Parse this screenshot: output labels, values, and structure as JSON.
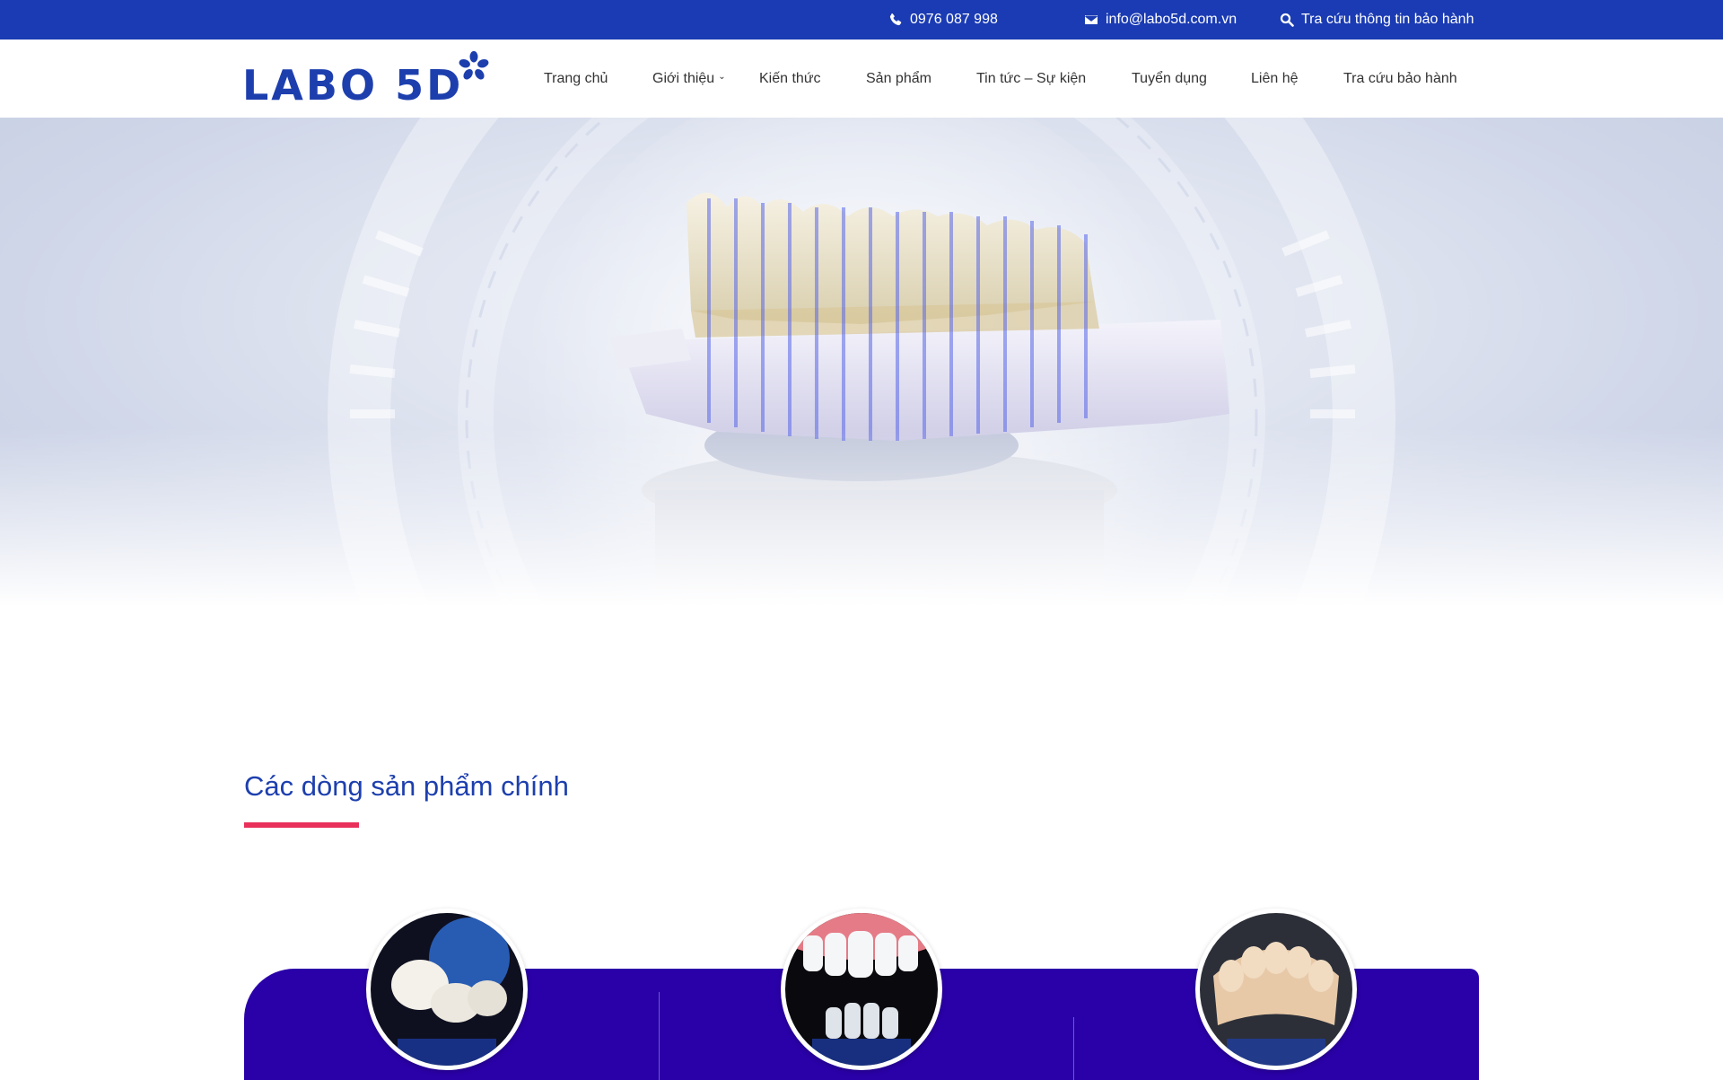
{
  "topbar": {
    "phone": "0976 087 998",
    "email": "info@labo5d.com.vn",
    "warranty_link": "Tra cứu thông tin bảo hành"
  },
  "logo": {
    "text": "LABO 5D"
  },
  "nav": {
    "items": [
      {
        "label": "Trang chủ"
      },
      {
        "label": "Giới thiệu",
        "has_dropdown": true
      },
      {
        "label": "Kiến thức"
      },
      {
        "label": "Sản phẩm"
      },
      {
        "label": "Tin tức – Sự kiện"
      },
      {
        "label": "Tuyển dụng"
      },
      {
        "label": "Liên hệ"
      },
      {
        "label": "Tra cứu bảo hành"
      }
    ]
  },
  "hero": {
    "image": "dental-model-3d-scan"
  },
  "products_section": {
    "title": "Các dòng sản phẩm chính",
    "cards": [
      {
        "image": "crown-bridge-teeth"
      },
      {
        "image": "veneer-smile-teeth"
      },
      {
        "image": "zirconia-dental-arch"
      }
    ]
  },
  "colors": {
    "topbar": "#1a3bb3",
    "brand_blue": "#1d3fae",
    "accent_pink": "#e8305a",
    "panel_purple": "#2a00a8"
  },
  "icons": {
    "phone": "phone-icon",
    "email": "envelope-icon",
    "search": "search-icon",
    "logo_mark": "flower-icon"
  }
}
